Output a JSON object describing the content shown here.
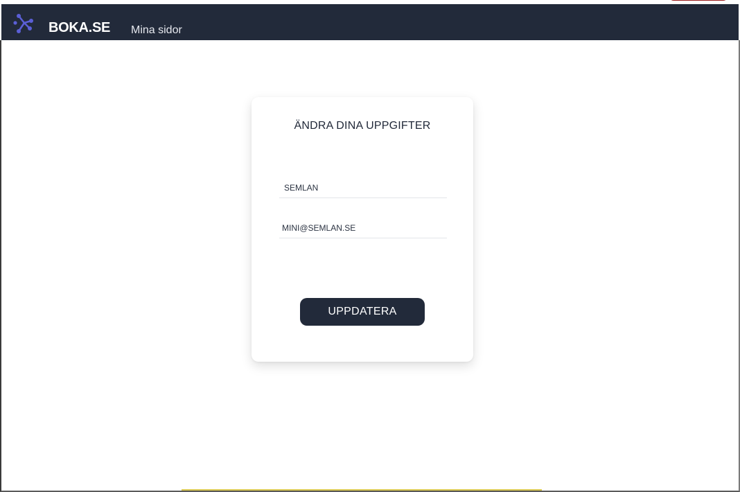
{
  "navbar": {
    "brand": "BOKA.SE",
    "link": "Mina sidor",
    "background": "#222a3a",
    "logo_color": "#5b5fd6",
    "logo_icon": "molecule-logo-icon"
  },
  "form": {
    "title": "ÄNDRA DINA UPPGIFTER",
    "name_value": "SEMLAN",
    "email_value": "MINI@SEMLAN.SE",
    "submit_label": "UPPDATERA"
  }
}
